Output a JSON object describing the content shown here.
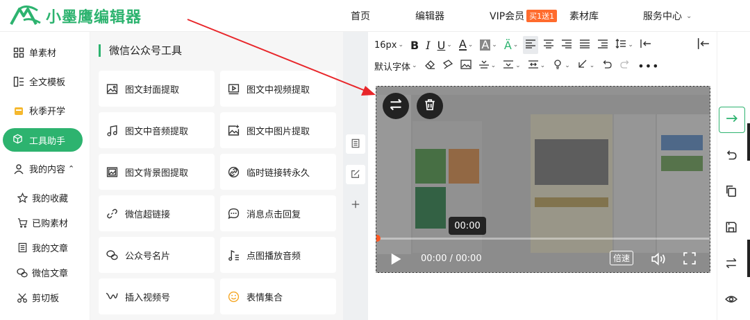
{
  "header": {
    "brand": "小墨鹰编辑器",
    "nav": {
      "home": "首页",
      "editor": "编辑器",
      "vip": "VIP会员",
      "vip_badge": "买1送1",
      "materials": "素材库",
      "service": "服务中心"
    },
    "brand_color": "#2db36f"
  },
  "sidebar": {
    "items": [
      {
        "label": "单素材",
        "icon": "grid-icon"
      },
      {
        "label": "全文模板",
        "icon": "template-icon"
      },
      {
        "label": "秋季开学",
        "icon": "folder-icon"
      },
      {
        "label": "工具助手",
        "icon": "cube-icon",
        "active": true
      },
      {
        "label": "我的内容",
        "icon": "user-icon"
      }
    ],
    "sub_items": [
      {
        "label": "我的收藏",
        "icon": "star-icon"
      },
      {
        "label": "已购素材",
        "icon": "cart-icon"
      },
      {
        "label": "我的文章",
        "icon": "document-icon"
      },
      {
        "label": "微信文章",
        "icon": "wechat-icon"
      },
      {
        "label": "剪切板",
        "icon": "scissors-icon"
      }
    ]
  },
  "panel": {
    "title": "微信公众号工具",
    "tools": [
      {
        "label": "图文封面提取",
        "icon": "image-icon"
      },
      {
        "label": "图文中视频提取",
        "icon": "video-icon"
      },
      {
        "label": "图文中音频提取",
        "icon": "music-icon"
      },
      {
        "label": "图文中图片提取",
        "icon": "image-plus-icon"
      },
      {
        "label": "图文背景图提取",
        "icon": "background-image-icon"
      },
      {
        "label": "临时链接转永久",
        "icon": "link-icon"
      },
      {
        "label": "微信超链接",
        "icon": "hyperlink-icon"
      },
      {
        "label": "消息点击回复",
        "icon": "message-icon"
      },
      {
        "label": "公众号名片",
        "icon": "wechat-card-icon"
      },
      {
        "label": "点图播放音频",
        "icon": "audio-icon"
      },
      {
        "label": "插入视频号",
        "icon": "channels-icon"
      },
      {
        "label": "表情集合",
        "icon": "emoji-icon"
      }
    ]
  },
  "toolbar": {
    "font_size": "16px",
    "font_family": "默认字体"
  },
  "video": {
    "center_time": "00:00",
    "current_time": "00:00",
    "duration": "00:00",
    "speed_label": "倍速"
  }
}
